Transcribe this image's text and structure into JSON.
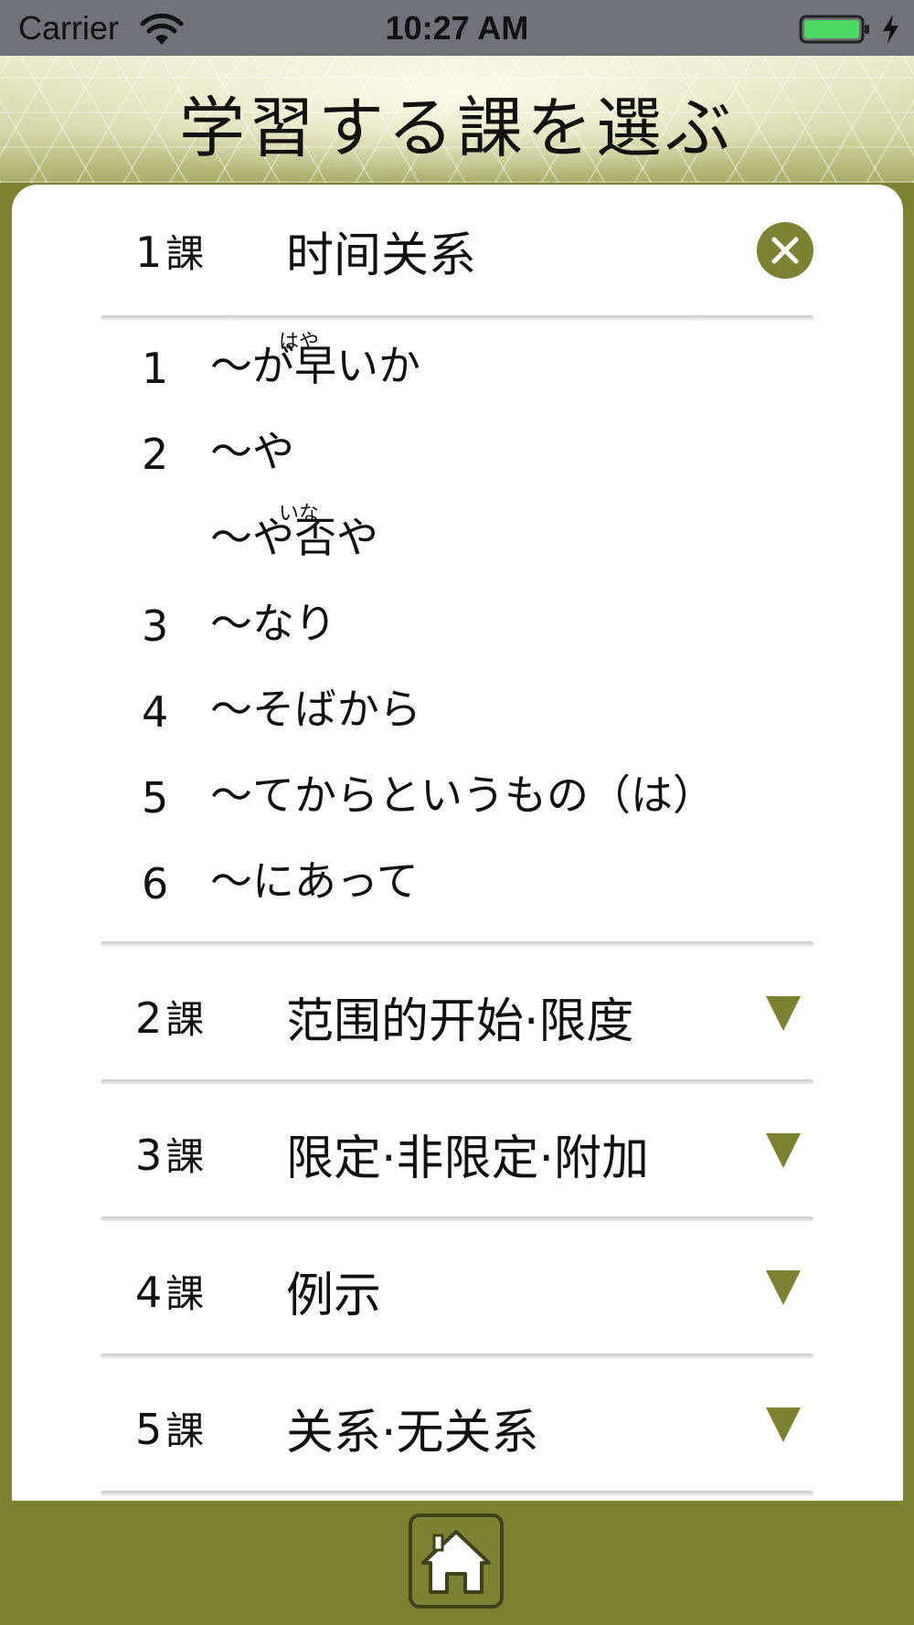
{
  "status_bar": {
    "carrier": "Carrier",
    "time": "10:27 AM",
    "wifi_icon": "wifi-icon",
    "battery_icon": "battery-icon",
    "charging_icon": "charging-icon",
    "battery_color": "#4cd964"
  },
  "header": {
    "title": "学習する課を選ぶ"
  },
  "lessons": [
    {
      "num": "1",
      "ka": "課",
      "title": "时间关系",
      "expanded": true,
      "control_icon": "close-icon",
      "items": [
        {
          "num": "1",
          "text": "～が早いか",
          "ruby": "はや"
        },
        {
          "num": "2",
          "text": "～や"
        },
        {
          "num": "",
          "text": "～や否や",
          "ruby": "いな"
        },
        {
          "num": "3",
          "text": "～なり"
        },
        {
          "num": "4",
          "text": "～そばから"
        },
        {
          "num": "5",
          "text": "～てからというもの（は）"
        },
        {
          "num": "6",
          "text": "～にあって"
        }
      ]
    },
    {
      "num": "2",
      "ka": "課",
      "title": "范围的开始·限度",
      "expanded": false,
      "control_icon": "triangle-down-icon"
    },
    {
      "num": "3",
      "ka": "課",
      "title": "限定·非限定·附加",
      "expanded": false,
      "control_icon": "triangle-down-icon"
    },
    {
      "num": "4",
      "ka": "課",
      "title": "例示",
      "expanded": false,
      "control_icon": "triangle-down-icon"
    },
    {
      "num": "5",
      "ka": "課",
      "title": "关系·无关系",
      "expanded": false,
      "control_icon": "triangle-down-icon"
    }
  ],
  "bottom_bar": {
    "home_icon": "home-icon"
  },
  "colors": {
    "accent": "#7c8232",
    "status_bar": "#6f7278",
    "card": "#ffffff",
    "text": "#111111"
  }
}
